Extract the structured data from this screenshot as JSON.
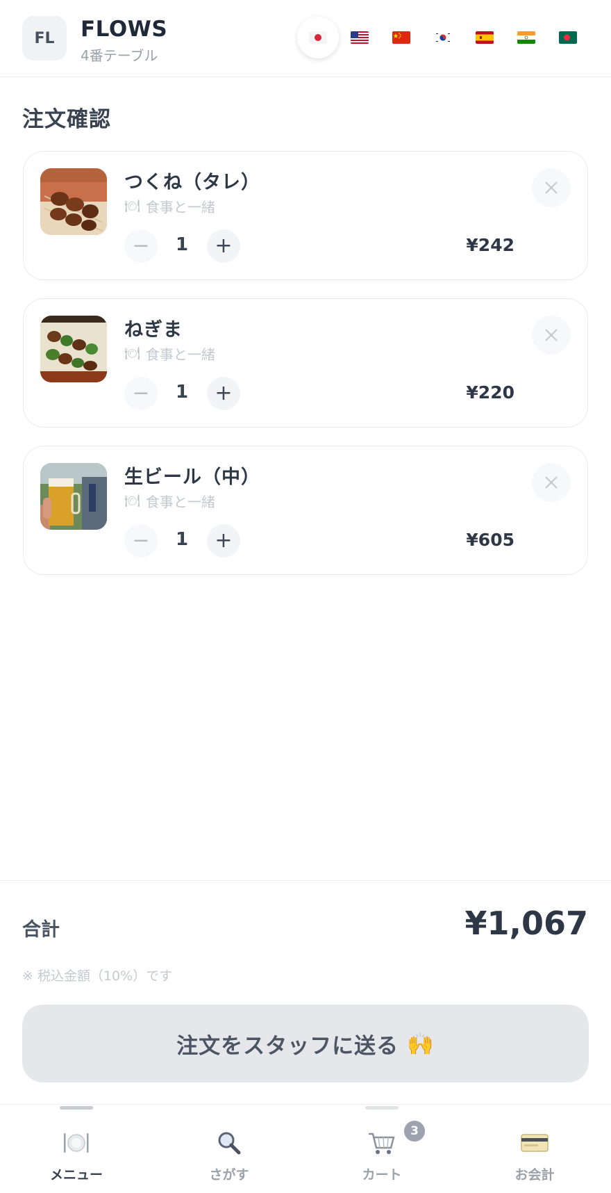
{
  "header": {
    "avatar": "FL",
    "shop_name": "FLOWS",
    "table": "4番テーブル",
    "languages": [
      {
        "code": "ja",
        "icon": "japan-flag-icon",
        "active": true
      },
      {
        "code": "en",
        "icon": "usa-flag-icon",
        "active": false
      },
      {
        "code": "zh",
        "icon": "china-flag-icon",
        "active": false
      },
      {
        "code": "ko",
        "icon": "korea-flag-icon",
        "active": false
      },
      {
        "code": "es",
        "icon": "spain-flag-icon",
        "active": false
      },
      {
        "code": "hi",
        "icon": "india-flag-icon",
        "active": false
      },
      {
        "code": "bn",
        "icon": "bangladesh-flag-icon",
        "active": false
      }
    ]
  },
  "page_title": "注文確認",
  "cart": {
    "items": [
      {
        "name": "つくね（タレ）",
        "note": "食事と一緒",
        "note_icon": "plate-icon",
        "qty": "1",
        "price": "¥242",
        "image": "tsukune-photo"
      },
      {
        "name": "ねぎま",
        "note": "食事と一緒",
        "note_icon": "plate-icon",
        "qty": "1",
        "price": "¥220",
        "image": "negima-photo"
      },
      {
        "name": "生ビール（中）",
        "note": "食事と一緒",
        "note_icon": "plate-icon",
        "qty": "1",
        "price": "¥605",
        "image": "beer-photo"
      }
    ],
    "minus_symbol": "−",
    "plus_symbol": "+"
  },
  "summary": {
    "total_label": "合計",
    "total_value": "¥1,067",
    "tax_note": "※ 税込金額（10%）です",
    "send_button_label": "注文をスタッフに送る",
    "send_button_emoji": "🙌"
  },
  "bottom_nav": {
    "items": [
      {
        "label": "メニュー",
        "icon": "plate-cutlery-icon",
        "active": true
      },
      {
        "label": "さがす",
        "icon": "magnifier-icon",
        "active": false
      },
      {
        "label": "カート",
        "icon": "cart-icon",
        "active": false,
        "badge": "3"
      },
      {
        "label": "お会計",
        "icon": "credit-card-icon",
        "active": false
      }
    ]
  },
  "colors": {
    "text_primary": "#2e3746",
    "text_muted": "#9aa1ab",
    "button_bg": "#e6e7eb",
    "badge_bg": "#9ca3af"
  }
}
